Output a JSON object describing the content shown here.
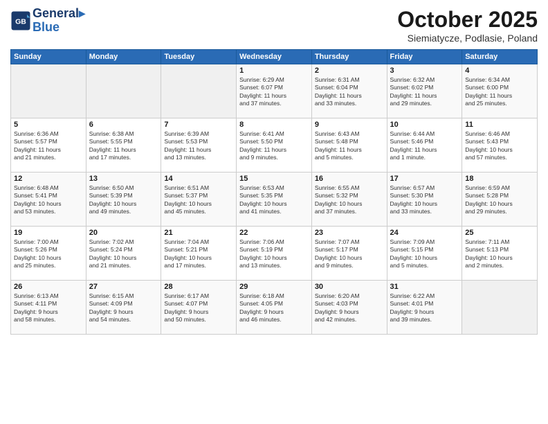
{
  "header": {
    "logo_line1": "General",
    "logo_line2": "Blue",
    "month": "October 2025",
    "location": "Siemiatycze, Podlasie, Poland"
  },
  "weekdays": [
    "Sunday",
    "Monday",
    "Tuesday",
    "Wednesday",
    "Thursday",
    "Friday",
    "Saturday"
  ],
  "weeks": [
    [
      {
        "day": "",
        "text": ""
      },
      {
        "day": "",
        "text": ""
      },
      {
        "day": "",
        "text": ""
      },
      {
        "day": "1",
        "text": "Sunrise: 6:29 AM\nSunset: 6:07 PM\nDaylight: 11 hours\nand 37 minutes."
      },
      {
        "day": "2",
        "text": "Sunrise: 6:31 AM\nSunset: 6:04 PM\nDaylight: 11 hours\nand 33 minutes."
      },
      {
        "day": "3",
        "text": "Sunrise: 6:32 AM\nSunset: 6:02 PM\nDaylight: 11 hours\nand 29 minutes."
      },
      {
        "day": "4",
        "text": "Sunrise: 6:34 AM\nSunset: 6:00 PM\nDaylight: 11 hours\nand 25 minutes."
      }
    ],
    [
      {
        "day": "5",
        "text": "Sunrise: 6:36 AM\nSunset: 5:57 PM\nDaylight: 11 hours\nand 21 minutes."
      },
      {
        "day": "6",
        "text": "Sunrise: 6:38 AM\nSunset: 5:55 PM\nDaylight: 11 hours\nand 17 minutes."
      },
      {
        "day": "7",
        "text": "Sunrise: 6:39 AM\nSunset: 5:53 PM\nDaylight: 11 hours\nand 13 minutes."
      },
      {
        "day": "8",
        "text": "Sunrise: 6:41 AM\nSunset: 5:50 PM\nDaylight: 11 hours\nand 9 minutes."
      },
      {
        "day": "9",
        "text": "Sunrise: 6:43 AM\nSunset: 5:48 PM\nDaylight: 11 hours\nand 5 minutes."
      },
      {
        "day": "10",
        "text": "Sunrise: 6:44 AM\nSunset: 5:46 PM\nDaylight: 11 hours\nand 1 minute."
      },
      {
        "day": "11",
        "text": "Sunrise: 6:46 AM\nSunset: 5:43 PM\nDaylight: 10 hours\nand 57 minutes."
      }
    ],
    [
      {
        "day": "12",
        "text": "Sunrise: 6:48 AM\nSunset: 5:41 PM\nDaylight: 10 hours\nand 53 minutes."
      },
      {
        "day": "13",
        "text": "Sunrise: 6:50 AM\nSunset: 5:39 PM\nDaylight: 10 hours\nand 49 minutes."
      },
      {
        "day": "14",
        "text": "Sunrise: 6:51 AM\nSunset: 5:37 PM\nDaylight: 10 hours\nand 45 minutes."
      },
      {
        "day": "15",
        "text": "Sunrise: 6:53 AM\nSunset: 5:35 PM\nDaylight: 10 hours\nand 41 minutes."
      },
      {
        "day": "16",
        "text": "Sunrise: 6:55 AM\nSunset: 5:32 PM\nDaylight: 10 hours\nand 37 minutes."
      },
      {
        "day": "17",
        "text": "Sunrise: 6:57 AM\nSunset: 5:30 PM\nDaylight: 10 hours\nand 33 minutes."
      },
      {
        "day": "18",
        "text": "Sunrise: 6:59 AM\nSunset: 5:28 PM\nDaylight: 10 hours\nand 29 minutes."
      }
    ],
    [
      {
        "day": "19",
        "text": "Sunrise: 7:00 AM\nSunset: 5:26 PM\nDaylight: 10 hours\nand 25 minutes."
      },
      {
        "day": "20",
        "text": "Sunrise: 7:02 AM\nSunset: 5:24 PM\nDaylight: 10 hours\nand 21 minutes."
      },
      {
        "day": "21",
        "text": "Sunrise: 7:04 AM\nSunset: 5:21 PM\nDaylight: 10 hours\nand 17 minutes."
      },
      {
        "day": "22",
        "text": "Sunrise: 7:06 AM\nSunset: 5:19 PM\nDaylight: 10 hours\nand 13 minutes."
      },
      {
        "day": "23",
        "text": "Sunrise: 7:07 AM\nSunset: 5:17 PM\nDaylight: 10 hours\nand 9 minutes."
      },
      {
        "day": "24",
        "text": "Sunrise: 7:09 AM\nSunset: 5:15 PM\nDaylight: 10 hours\nand 5 minutes."
      },
      {
        "day": "25",
        "text": "Sunrise: 7:11 AM\nSunset: 5:13 PM\nDaylight: 10 hours\nand 2 minutes."
      }
    ],
    [
      {
        "day": "26",
        "text": "Sunrise: 6:13 AM\nSunset: 4:11 PM\nDaylight: 9 hours\nand 58 minutes."
      },
      {
        "day": "27",
        "text": "Sunrise: 6:15 AM\nSunset: 4:09 PM\nDaylight: 9 hours\nand 54 minutes."
      },
      {
        "day": "28",
        "text": "Sunrise: 6:17 AM\nSunset: 4:07 PM\nDaylight: 9 hours\nand 50 minutes."
      },
      {
        "day": "29",
        "text": "Sunrise: 6:18 AM\nSunset: 4:05 PM\nDaylight: 9 hours\nand 46 minutes."
      },
      {
        "day": "30",
        "text": "Sunrise: 6:20 AM\nSunset: 4:03 PM\nDaylight: 9 hours\nand 42 minutes."
      },
      {
        "day": "31",
        "text": "Sunrise: 6:22 AM\nSunset: 4:01 PM\nDaylight: 9 hours\nand 39 minutes."
      },
      {
        "day": "",
        "text": ""
      }
    ]
  ]
}
